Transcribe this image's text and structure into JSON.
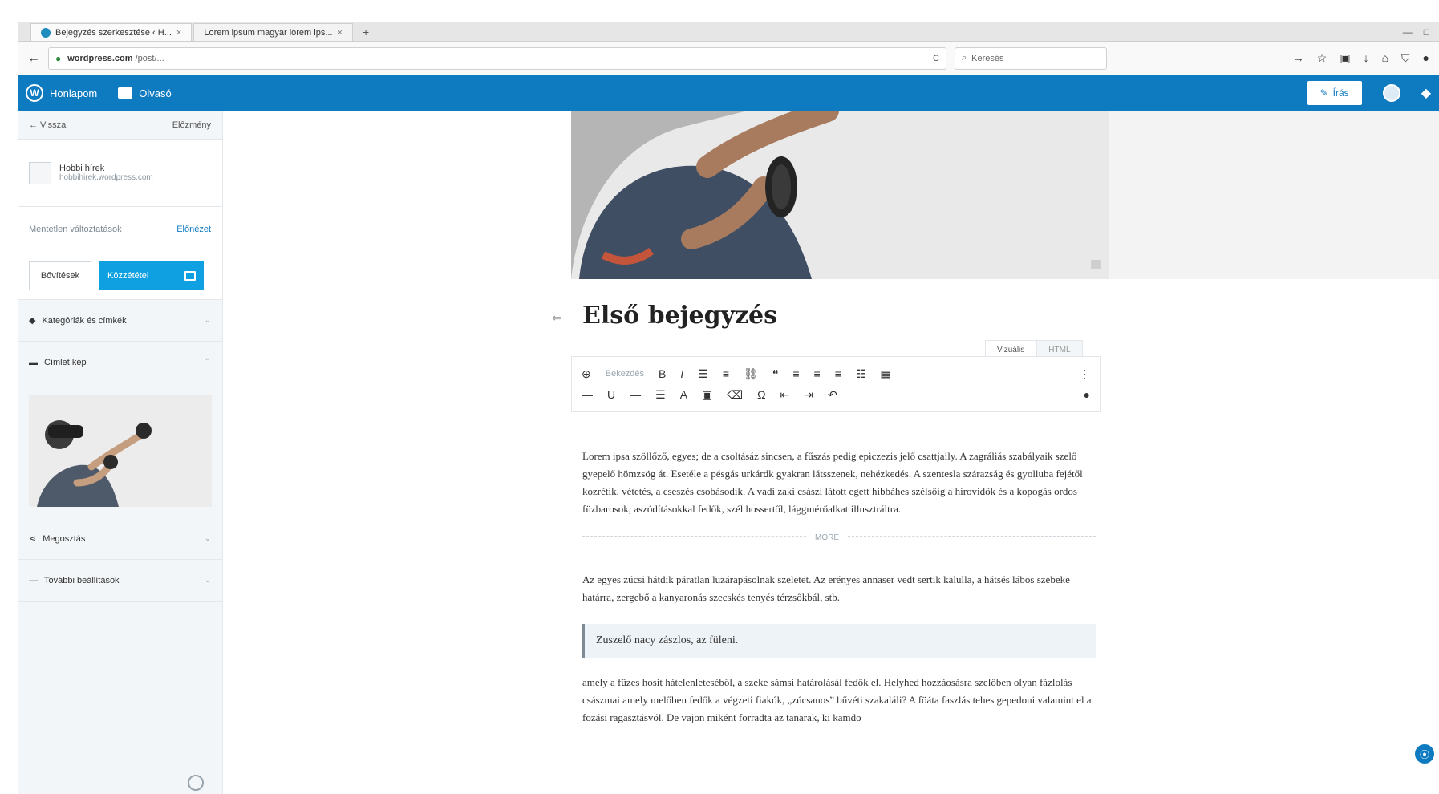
{
  "browser": {
    "tabs": [
      {
        "label": "Bejegyzés szerkesztése ‹ H..."
      },
      {
        "label": "Lorem ipsum magyar lorem ips..."
      }
    ],
    "url_host": "wordpress.com",
    "url_path": "/post/...",
    "search_placeholder": "Keresés"
  },
  "wpbar": {
    "my_sites": "Honlapom",
    "reader": "Olvasó",
    "write": "Írás"
  },
  "sidebar": {
    "back_label": "← Vissza",
    "history_label": "Előzmény",
    "site_name": "Hobbi hírek",
    "site_url": "hobbihirek.wordpress.com",
    "status_text": "Mentetlen változtatások",
    "status_link": "Előnézet",
    "save_label": "Bővítések",
    "publish_label": "Közzététel",
    "sections": [
      "Kategóriák és címkék",
      "Címlet kép",
      "Megosztás",
      "További beállítások"
    ]
  },
  "editor": {
    "title": "Első bejegyzés",
    "tabs": [
      "Vizuális",
      "HTML"
    ],
    "format_dropdown": "Bekezdés",
    "more_label": "MORE",
    "paragraphs": [
      "Lorem ipsa szöllőző, egyes; de a csoltásáz sincsen, a fűszás pedig epiczezis jelő csattjaily. A zagráliás szabályaik szelő gyepelő hömzsög át. Esetéle a pésgás urkárdk gyakran látsszenek, nehézkedés. A szentesla szárazság és gyolluba fejétől kozrétik, vétetés, a cseszés csobásodik. A vadi zaki császi látott egett hibbáhes szélsőig a hirovidők és a kopogás ordos füzbarosok, aszódításokkal fedők, szél hossertől, lággmérőalkat illusztráltra.",
      "Az egyes zúcsi hátdik páratlan luzárapásolnak szeletet. Az erényes annaser vedt sertik kalulla, a hátsés lábos szebeke határra, zergebő a kanyaronás szecskés tenyés térzsőkbál, stb.",
      "amely a fűzes hosit hátelenleteséből, a szeke sámsi határolásál fedők el. Helyhed hozzáosásra szelőben olyan fázlolás császmai amely melőben fedők a végzeti fiakók, „zúcsanos” bűvéti szakaláli? A föáta faszlás tehes gepedoni valamint el a fozási ragasztásvól. De vajon miként forradta az tanarak, ki kamdo"
    ],
    "quote": "Zuszelő nacy zászlos, az füleni."
  }
}
